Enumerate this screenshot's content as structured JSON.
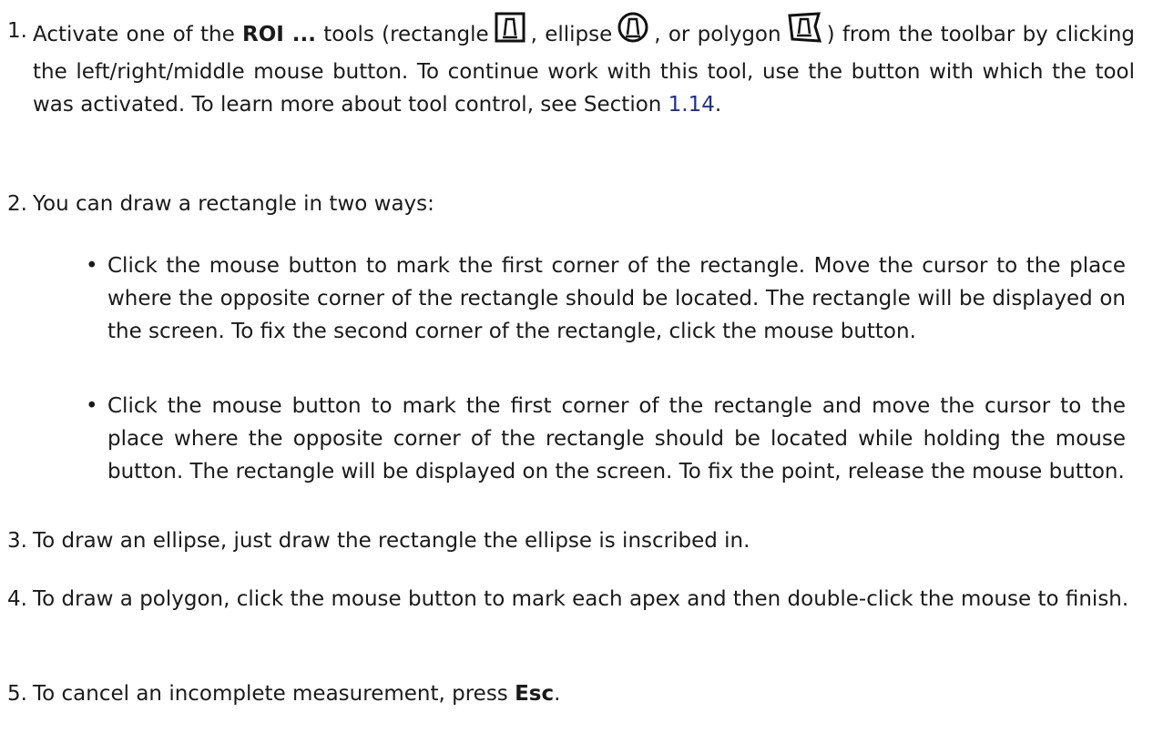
{
  "steps": [
    {
      "number": "1.",
      "part_a": "Activate one of the ",
      "bold": "ROI ...",
      "part_b": " tools (rectangle",
      "part_c": ", ellipse",
      "part_d": ", or polygon",
      "part_e": ") from the toolbar by clicking the left/right/middle mouse button. To continue work with this tool, use the button with which the tool was activated. To learn more about tool control, see Section ",
      "link": "1.14",
      "part_f": ".",
      "icons": [
        "roi-rectangle-icon",
        "roi-ellipse-icon",
        "roi-polygon-icon"
      ]
    },
    {
      "number": "2.",
      "text": "You can draw a rectangle in two ways:"
    },
    {
      "number": "3.",
      "text": "To draw an ellipse, just draw the rectangle the ellipse is inscribed in."
    },
    {
      "number": "4.",
      "text": "To draw a polygon, click the mouse button to mark each apex and then double-click the mouse to finish."
    },
    {
      "number": "5.",
      "part_a": "To cancel an incomplete measurement, press ",
      "bold": "Esc",
      "part_b": "."
    }
  ],
  "bullets": [
    "Click the mouse button to mark the first corner of the rectangle. Move the cursor to the place where the opposite corner of the rectangle should be located. The rectangle will be displayed on the screen. To fix the second corner of the rectangle, click the mouse button.",
    "Click the mouse button to mark the first corner of the rectangle and move the cursor to the place where the opposite corner of the rectangle should be located while holding the mouse button. The rectangle will be displayed on the screen. To fix the point, release the mouse button."
  ],
  "bullet_glyph": "•"
}
